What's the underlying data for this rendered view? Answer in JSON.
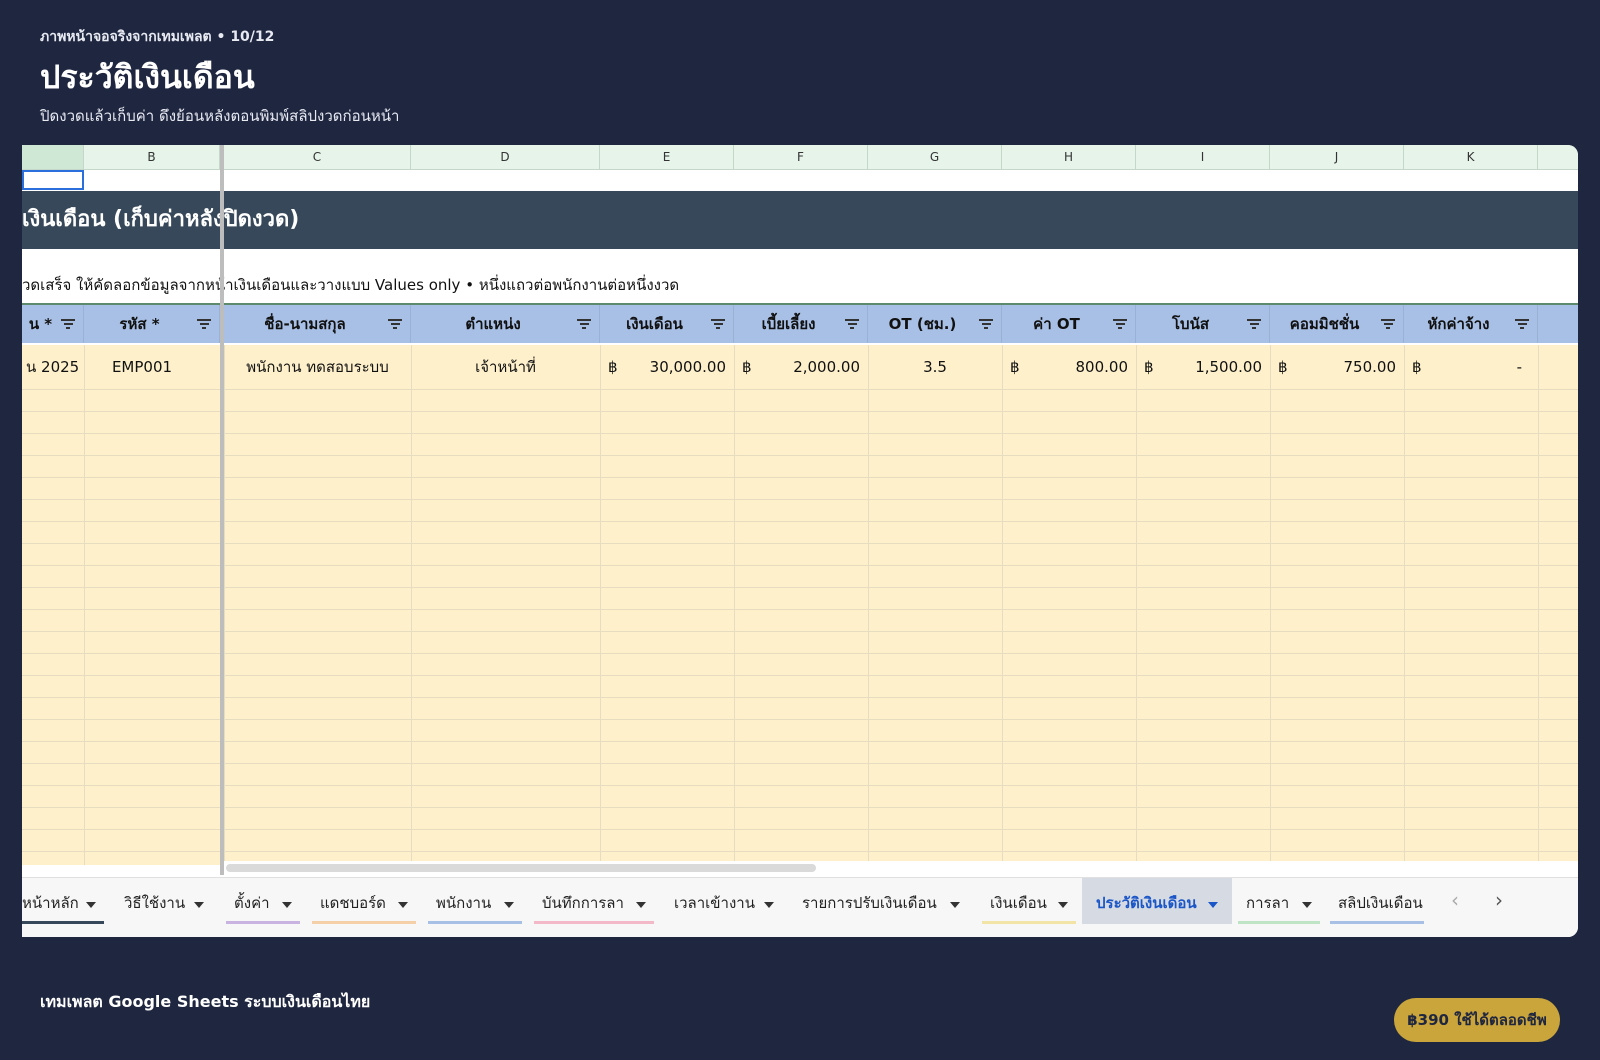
{
  "page": {
    "eyebrow": "ภาพหน้าจอจริงจากเทมเพลต • 10/12",
    "title": "ประวัติเงินเดือน",
    "subtitle": "ปิดงวดแล้วเก็บค่า ดึงย้อนหลังตอนพิมพ์สลิปงวดก่อนหน้า"
  },
  "sheet": {
    "column_letters": [
      "",
      "B",
      "C",
      "D",
      "E",
      "F",
      "G",
      "H",
      "I",
      "J",
      "K"
    ],
    "banner": "เงินเดือน (เก็บค่าหลังปิดงวด)",
    "note": "วดเสร็จ ให้คัดลอกข้อมูลจากหน้าเงินเดือนและวางแบบ Values only • หนึ่งแถวต่อพนักงานต่อหนึ่งงวด",
    "headers": [
      "น *",
      "รหัส *",
      "ชื่อ-นามสกุล",
      "ตำแหน่ง",
      "เงินเดือน",
      "เบี้ยเลี้ยง",
      "OT (ชม.)",
      "ค่า OT",
      "โบนัส",
      "คอมมิชชั่น",
      "หักค่าจ้าง"
    ],
    "row1": {
      "period": "น 2025",
      "id": "EMP001",
      "name": "พนักงาน ทดสอบระบบ",
      "position": "เจ้าหน้าที่",
      "currency": "฿",
      "salary": "30,000.00",
      "allowance": "2,000.00",
      "ot_hours": "3.5",
      "ot_pay": "800.00",
      "bonus": "1,500.00",
      "commission": "750.00",
      "deduction": "-"
    }
  },
  "tabs": [
    {
      "label": "หน้าหลัก",
      "color": "#37485a"
    },
    {
      "label": "วิธีใช้งาน",
      "color": ""
    },
    {
      "label": "ตั้งค่า",
      "color": "#c9b3e0"
    },
    {
      "label": "แดชบอร์ด",
      "color": "#f4cfa8"
    },
    {
      "label": "พนักงาน",
      "color": "#a9c0e6"
    },
    {
      "label": "บันทึกการลา",
      "color": "#f3b9c9"
    },
    {
      "label": "เวลาเข้างาน",
      "color": ""
    },
    {
      "label": "รายการปรับเงินเดือน",
      "color": ""
    },
    {
      "label": "เงินเดือน",
      "color": "#f1e4a6"
    },
    {
      "label": "ประวัติเงินเดือน",
      "color": ""
    },
    {
      "label": "การลา",
      "color": "#bfe3c5"
    },
    {
      "label": "สลิปเงินเดือน",
      "color": "#a9c0e6"
    }
  ],
  "footer": {
    "left": "เทมเพลต Google Sheets ระบบเงินเดือนไทย",
    "price": "฿390 ใช้ได้ตลอดชีพ"
  }
}
